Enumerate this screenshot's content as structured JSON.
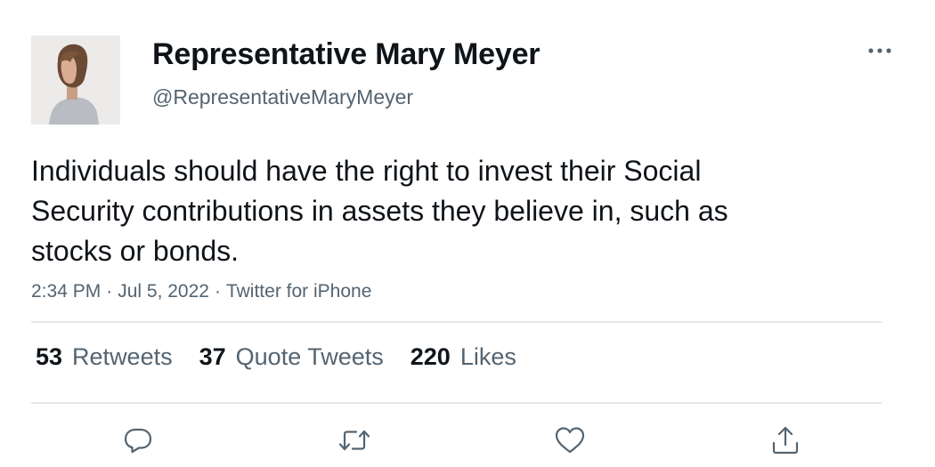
{
  "author": {
    "display_name": "Representative Mary Meyer",
    "handle": "@RepresentativeMaryMeyer",
    "avatar_icon": "profile-photo"
  },
  "tweet": {
    "text": "Individuals should have the right to invest their Social Security contributions in assets they believe in, such as stocks or bonds.",
    "time": "2:34 PM",
    "date": "Jul 5, 2022",
    "source": "Twitter for iPhone",
    "separator": "·"
  },
  "stats": {
    "retweets": {
      "count": "53",
      "label": "Retweets"
    },
    "quote_tweets": {
      "count": "37",
      "label": "Quote Tweets"
    },
    "likes": {
      "count": "220",
      "label": "Likes"
    }
  },
  "actions": [
    "reply-icon",
    "retweet-icon",
    "like-icon",
    "share-icon"
  ],
  "colors": {
    "text_primary": "#0f1419",
    "text_secondary": "#536471",
    "divider": "#e3e7ea"
  }
}
